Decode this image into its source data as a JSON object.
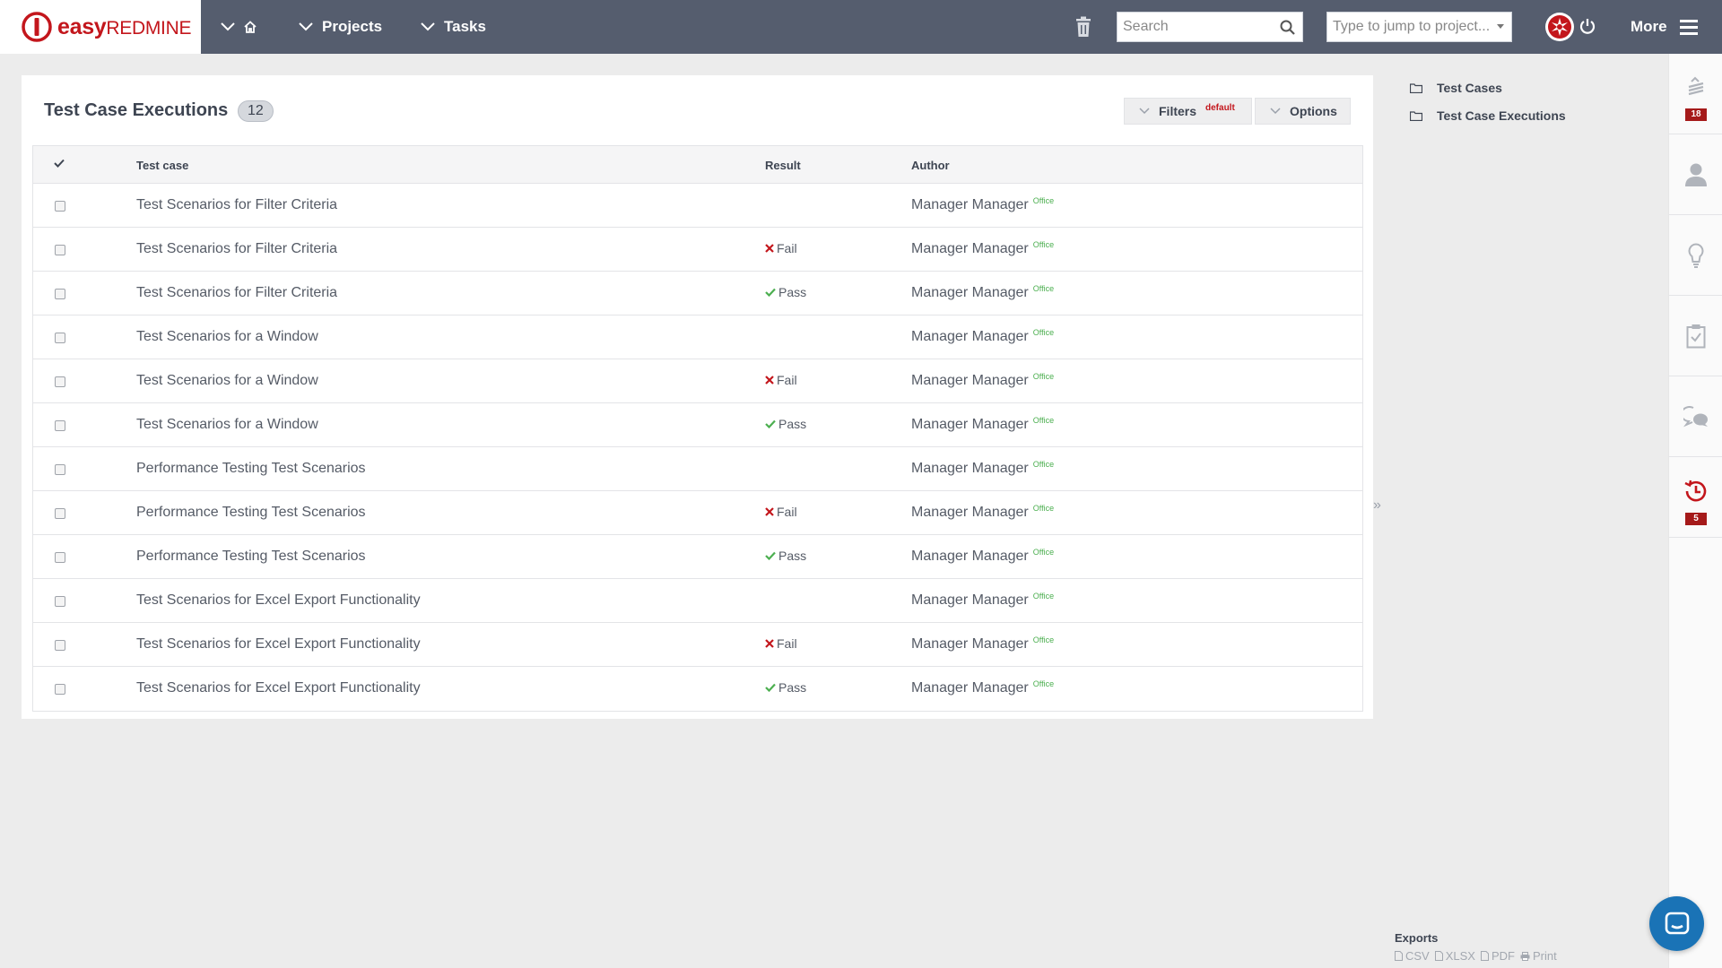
{
  "brand": {
    "name_bold": "easy",
    "name_rest": "REDMINE",
    "color": "#c3161c"
  },
  "nav": {
    "home_icon": "home-icon",
    "projects_label": "Projects",
    "tasks_label": "Tasks",
    "more_label": "More"
  },
  "search": {
    "placeholder": "Search"
  },
  "jump": {
    "placeholder": "Type to jump to project..."
  },
  "page": {
    "title": "Test Case Executions",
    "count": "12",
    "filters_label": "Filters",
    "filters_tag": "default",
    "options_label": "Options"
  },
  "table": {
    "headers": {
      "test_case": "Test case",
      "result": "Result",
      "author": "Author"
    },
    "rows": [
      {
        "case": "Test Scenarios for Filter Criteria",
        "result": "",
        "author": "Manager Manager",
        "tag": "Office"
      },
      {
        "case": "Test Scenarios for Filter Criteria",
        "result": "Fail",
        "author": "Manager Manager",
        "tag": "Office"
      },
      {
        "case": "Test Scenarios for Filter Criteria",
        "result": "Pass",
        "author": "Manager Manager",
        "tag": "Office"
      },
      {
        "case": "Test Scenarios for a Window",
        "result": "",
        "author": "Manager Manager",
        "tag": "Office"
      },
      {
        "case": "Test Scenarios for a Window",
        "result": "Fail",
        "author": "Manager Manager",
        "tag": "Office"
      },
      {
        "case": "Test Scenarios for a Window",
        "result": "Pass",
        "author": "Manager Manager",
        "tag": "Office"
      },
      {
        "case": "Performance Testing Test Scenarios",
        "result": "",
        "author": "Manager Manager",
        "tag": "Office"
      },
      {
        "case": "Performance Testing Test Scenarios",
        "result": "Fail",
        "author": "Manager Manager",
        "tag": "Office"
      },
      {
        "case": "Performance Testing Test Scenarios",
        "result": "Pass",
        "author": "Manager Manager",
        "tag": "Office"
      },
      {
        "case": "Test Scenarios for Excel Export Functionality",
        "result": "",
        "author": "Manager Manager",
        "tag": "Office"
      },
      {
        "case": "Test Scenarios for Excel Export Functionality",
        "result": "Fail",
        "author": "Manager Manager",
        "tag": "Office"
      },
      {
        "case": "Test Scenarios for Excel Export Functionality",
        "result": "Pass",
        "author": "Manager Manager",
        "tag": "Office"
      }
    ]
  },
  "sidebar": {
    "links": [
      "Test Cases",
      "Test Case Executions"
    ],
    "exports_title": "Exports",
    "exports": [
      "CSV",
      "XLSX",
      "PDF",
      "Print"
    ]
  },
  "dock": {
    "items": [
      {
        "icon": "activity-stack-icon",
        "badge": "18"
      },
      {
        "icon": "user-icon",
        "badge": ""
      },
      {
        "icon": "lightbulb-icon",
        "badge": ""
      },
      {
        "icon": "clipboard-check-icon",
        "badge": ""
      },
      {
        "icon": "chat-icon",
        "badge": ""
      },
      {
        "icon": "history-clock-icon",
        "badge": "5"
      }
    ]
  },
  "colors": {
    "topbar": "#555d6e",
    "fail": "#c3161c",
    "pass": "#4caf50",
    "badge": "#a51a1a"
  }
}
